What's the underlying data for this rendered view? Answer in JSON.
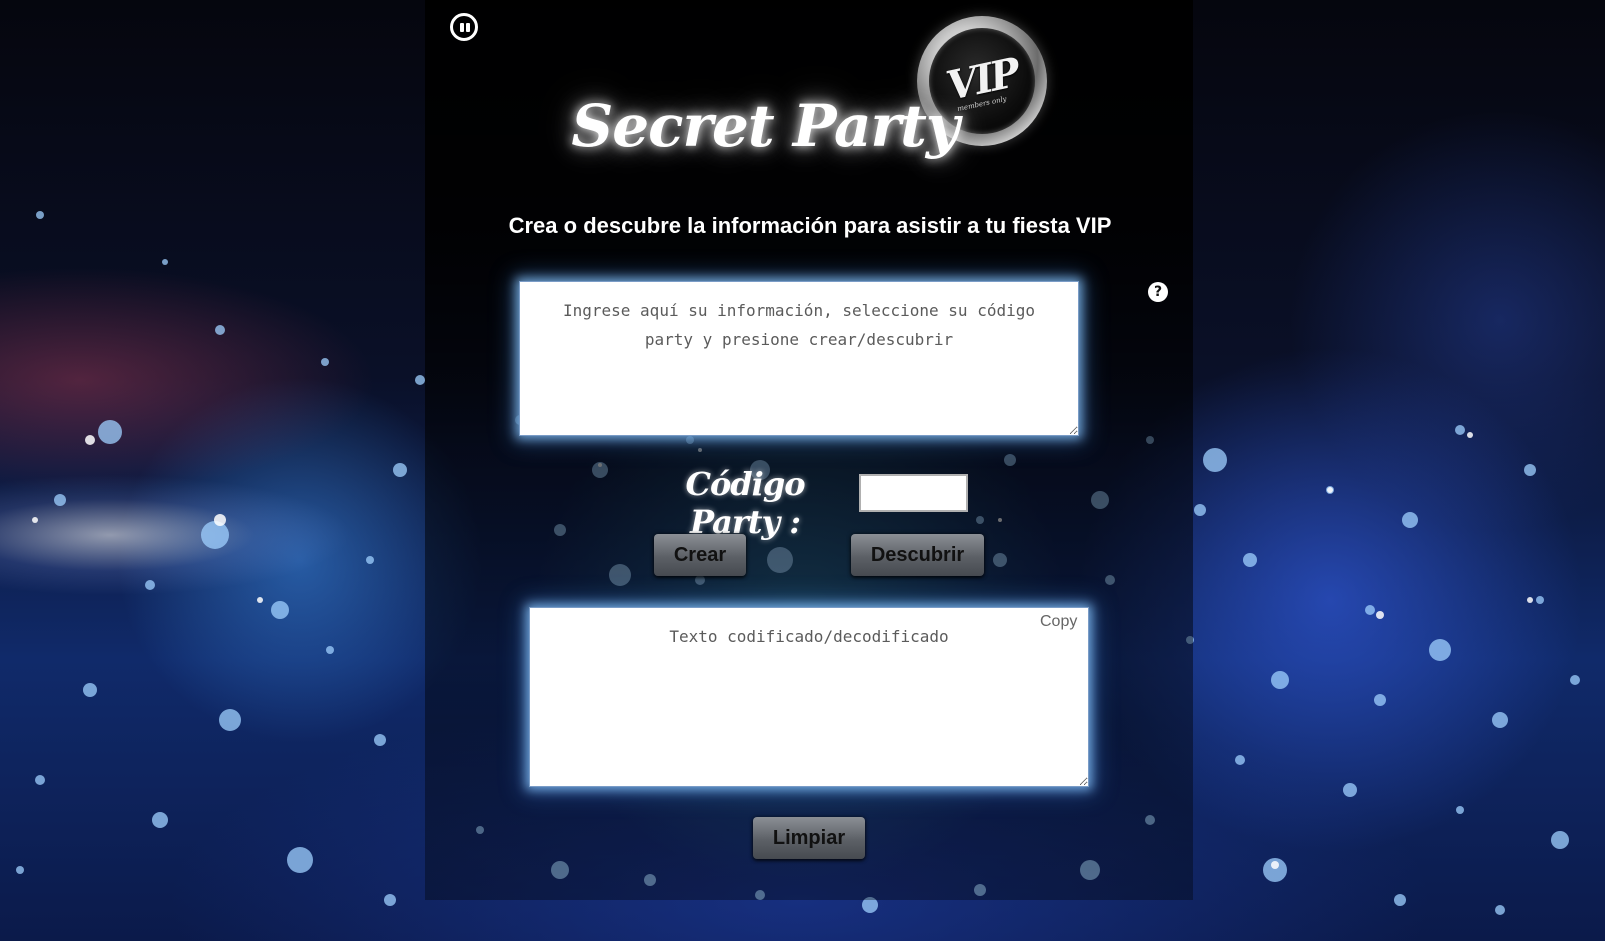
{
  "header": {
    "title": "Secret Party",
    "subtitle": "Crea o descubre la información para asistir a tu fiesta VIP"
  },
  "badge": {
    "text": "VIP",
    "subtext": "members only"
  },
  "icons": {
    "pause": "pause-icon",
    "help": "question-icon",
    "help_glyph": "?"
  },
  "input": {
    "placeholder": "Ingrese aquí su información, seleccione su código party y presione crear/descubrir",
    "value": ""
  },
  "code": {
    "label": "Código Party :",
    "value": ""
  },
  "buttons": {
    "create": "Crear",
    "discover": "Descubrir",
    "clear": "Limpiar"
  },
  "output": {
    "placeholder": "Texto codificado/decodificado",
    "value": "",
    "copy_label": "Copy"
  },
  "colors": {
    "background": "#0b1a4a",
    "panel": "#000000",
    "glow": "#8cc8ff",
    "button": "#5c6066"
  }
}
